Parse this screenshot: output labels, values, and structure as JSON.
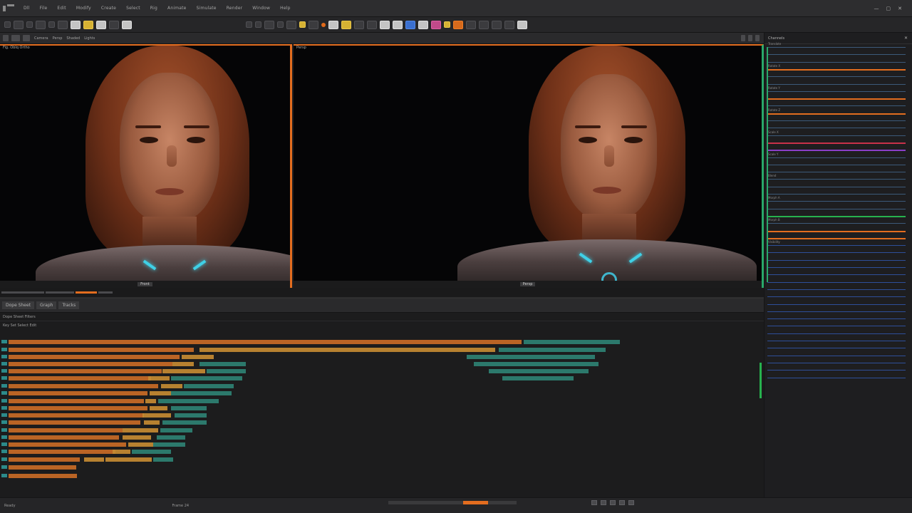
{
  "menubar": {
    "items": [
      "Dll",
      "File",
      "Edit",
      "Modify",
      "Create",
      "Select",
      "Rig",
      "Animate",
      "Simulate",
      "Render",
      "Window",
      "Help"
    ],
    "window_controls": [
      "—",
      "▢",
      "✕"
    ]
  },
  "viewbar": {
    "labels": [
      "Camera",
      "Persp",
      "Shaded",
      "Lights"
    ]
  },
  "viewport_left": {
    "caption": "Fig. Oblq Ortho",
    "footer": "Front"
  },
  "viewport_right": {
    "caption": "Persp",
    "footer": "Persp"
  },
  "timeline": {
    "tabs": [
      "Dope Sheet",
      "Graph",
      "Tracks"
    ],
    "ruler_label": "Dope Sheet  Filters",
    "sub_label": "Key  Set  Select  Edit"
  },
  "right_panel": {
    "title": "Channels",
    "close": "✕",
    "labels": [
      "Translate",
      "Rotate X",
      "Rotate Y",
      "Rotate Z",
      "Scale X",
      "Scale Y",
      "Blend",
      "Morph A",
      "Morph B",
      "Visibility",
      "Jaw",
      "Brow L",
      "Brow R",
      "Eye L",
      "Eye R",
      "Neck",
      "Spine",
      "Root"
    ]
  },
  "statusbar": {
    "left": "Ready",
    "center": "Frame 24"
  },
  "colors": {
    "accent_orange": "#e36d1f",
    "accent_teal": "#2aa86a",
    "glow_cyan": "#3fd0e6",
    "track_orange": "#c86a26",
    "track_gold": "#c48a32",
    "track_teal": "#2f8a7a"
  }
}
